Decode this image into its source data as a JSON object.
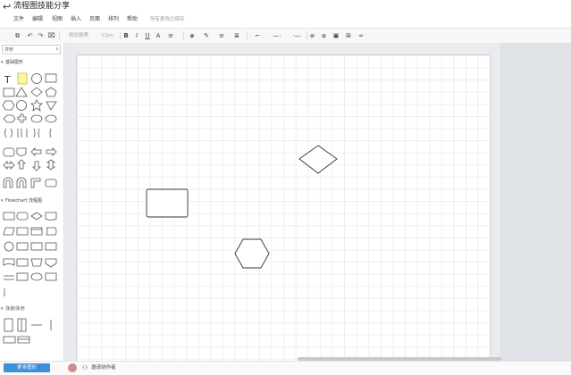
{
  "title": "流程图技能分享",
  "menu": [
    "文件",
    "编辑",
    "视图",
    "插入",
    "页面",
    "排列",
    "帮助"
  ],
  "save_status": "所有更改已保存",
  "toolbar": {
    "font_family": "微软雅黑",
    "font_size": "12px",
    "bold": "B",
    "italic": "I",
    "underline": "U",
    "font_color": "A"
  },
  "sidebar": {
    "search_placeholder": "搜索",
    "sections": [
      {
        "label": "基础图形"
      },
      {
        "label": "Flowchart 流程图"
      },
      {
        "label": "泳道/泳池"
      }
    ]
  },
  "footer": {
    "more_shapes": "更多图形",
    "invite": "邀请协作者"
  },
  "canvas": {
    "shapes": [
      "rectangle",
      "diamond",
      "hexagon"
    ]
  }
}
